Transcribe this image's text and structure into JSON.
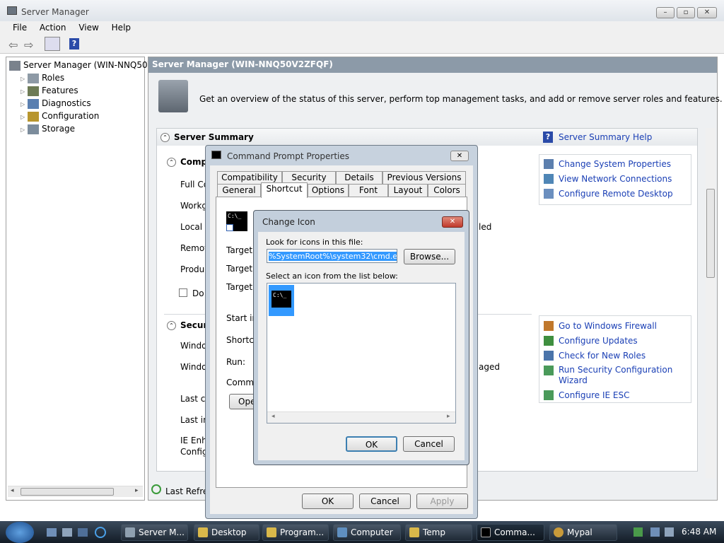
{
  "window": {
    "title": "Server Manager",
    "min": "–",
    "max": "▫",
    "close": "✕"
  },
  "menu": [
    "File",
    "Action",
    "View",
    "Help"
  ],
  "tree": {
    "root": "Server Manager (WIN-NNQ50V2",
    "items": [
      "Roles",
      "Features",
      "Diagnostics",
      "Configuration",
      "Storage"
    ]
  },
  "main": {
    "header": "Server Manager (WIN-NNQ50V2ZFQF)",
    "overview": "Get an overview of the status of this server, perform top management tasks, and add or remove server roles and features.",
    "summary_title": "Server Summary",
    "summary_help": "Server Summary Help",
    "computer_section": "Compu",
    "rows_left": [
      "Full Co",
      "Workg",
      "Local A",
      "Remot",
      "Produc"
    ],
    "checkbox_label": "Do n",
    "right_fragments": {
      "led": "led",
      "aged": "aged"
    },
    "links1": [
      "Change System Properties",
      "View Network Connections",
      "Configure Remote Desktop"
    ],
    "security_section": "Securi",
    "sec_rows": [
      "Windo",
      "Windo",
      "Last ch",
      "Last ins",
      "IE Enha",
      "Config"
    ],
    "links2": [
      "Go to Windows Firewall",
      "Configure Updates",
      "Check for New Roles",
      "Run Security Configuration",
      "Wizard",
      "Configure IE ESC"
    ],
    "last_refresh": "Last Refres"
  },
  "cmd_props": {
    "title": "Command Prompt Properties",
    "tabs_row1": [
      "Compatibility",
      "Security",
      "Details",
      "Previous Versions"
    ],
    "tabs_row2": [
      "General",
      "Shortcut",
      "Options",
      "Font",
      "Layout",
      "Colors"
    ],
    "fields": [
      "Target ty",
      "Target lo",
      "Target:",
      "Start in:",
      "Shortcut",
      "Run:",
      "Commen"
    ],
    "open_btn": "Ope",
    "ok": "OK",
    "cancel": "Cancel",
    "apply": "Apply"
  },
  "change_icon": {
    "title": "Change Icon",
    "look_label": "Look for icons in this file:",
    "file_value": "%SystemRoot%\\system32\\cmd.exe",
    "browse": "Browse...",
    "select_label": "Select an icon from the list below:",
    "ok": "OK",
    "cancel": "Cancel",
    "icon_text": "C:\\_"
  },
  "taskbar": {
    "tasks": [
      "Server M...",
      "Desktop",
      "Program...",
      "Computer",
      "Temp",
      "Comma...",
      "Mypal"
    ],
    "clock": "6:48 AM"
  },
  "colors": {
    "accent": "#1a3fb5",
    "header_bg": "#8c9aa8",
    "taskbar": "#1b2633"
  }
}
